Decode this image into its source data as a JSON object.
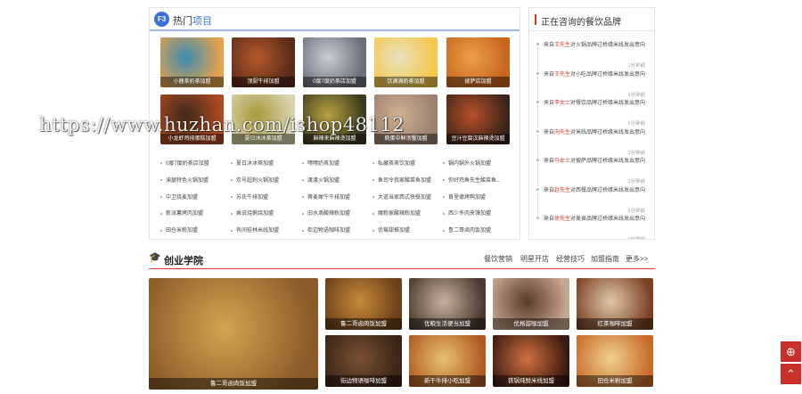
{
  "hot": {
    "badge": "F3",
    "title_pre": "热门",
    "title_post": "项目",
    "images": [
      {
        "caption": "小鹿茶奶茶加盟",
        "c1": "#e9a24c",
        "c2": "#3a8bb0"
      },
      {
        "caption": "顶厨牛排加盟",
        "c1": "#5a2a1a",
        "c2": "#b55a2a"
      },
      {
        "caption": "0度7度奶茶店加盟",
        "c1": "#6b6f7a",
        "c2": "#c8ccd4"
      },
      {
        "caption": "饮满满奶茶加盟",
        "c1": "#f5c84a",
        "c2": "#e8e0c0"
      },
      {
        "caption": "披萨店加盟",
        "c1": "#c8641e",
        "c2": "#e9a04a"
      },
      {
        "caption": "小龙虾鸡排蛋糕加盟",
        "c1": "#b04a22",
        "c2": "#3d2a1a"
      },
      {
        "caption": "夏日沐沐茶加盟",
        "c1": "#d8d4b0",
        "c2": "#a89a3a"
      },
      {
        "caption": "麻辣来麻辣烫加盟",
        "c1": "#3b3a20",
        "c2": "#b8a040"
      },
      {
        "caption": "蚝蛋中鲜汤蟹加盟",
        "c1": "#9a8070",
        "c2": "#d0b090"
      },
      {
        "caption": "豆汁豆腐汉麻辣烫加盟",
        "c1": "#3a2418",
        "c2": "#b8502a"
      }
    ],
    "tags": [
      "0度7度奶茶店加盟",
      "夏日沐沐茶加盟",
      "嘿嘿奶茶加盟",
      "私藏茶茶饮加盟",
      "锅内锅外火锅加盟",
      "渝瑟特色火锅加盟",
      "欢号超刺火锅加盟",
      "渡渡火锅加盟",
      "鱼司令我家酸菜鱼加盟",
      "你好鸡鱼先生酸菜鱼...",
      "中卫烧麦加盟",
      "苏氏牛排加盟",
      "蒋麦犀牛牛排加盟",
      "大道当家西式快餐加盟",
      "首里德烤鸭加盟",
      "新派薯烤肉加盟",
      "乘说烧鹅烧加盟",
      "旧水滴酸辣粉加盟",
      "魔粉家酸辣粉加盟",
      "西少冬肉夹馍加盟",
      "田仓米粉加盟",
      "有间桂林米线加盟",
      "街边物语咖啡加盟",
      "优莓甜推加盟",
      "鲁二哥卤肉饭加盟"
    ]
  },
  "consult": {
    "title": "正在咨询的餐饮品牌",
    "items": [
      {
        "pre": "来自",
        "name": "王先生",
        "post": "对火锅品牌过桥缘米线发出意向",
        "time": "1分钟前"
      },
      {
        "pre": "来自",
        "name": "王先生",
        "post": "对小吃品牌过桥缘米线发出意向",
        "time": "1分钟前"
      },
      {
        "pre": "来自",
        "name": "李女士",
        "post": "对餐饮品牌过桥缘米线发出意向",
        "time": "1分钟前"
      },
      {
        "pre": "来自",
        "name": "向先生",
        "post": "对米线品牌过桥缘米线发出意向",
        "time": "1分钟前"
      },
      {
        "pre": "来自",
        "name": "马女士",
        "post": "对披萨品牌过桥缘米线发出意向",
        "time": "1分钟前"
      },
      {
        "pre": "来自",
        "name": "赵先生",
        "post": "对西餐品牌过桥缘米线发出意向",
        "time": "1分钟前"
      },
      {
        "pre": "来自",
        "name": "徐先生",
        "post": "对美食品牌过桥缘米线发出意向",
        "time": "1分钟前"
      }
    ]
  },
  "academy": {
    "icon": "🎓",
    "title": "创业学院",
    "links": [
      "餐饮营销",
      "明星开店",
      "经营技巧",
      "加盟指南",
      "更多>>"
    ],
    "feature": {
      "caption": "鲁二哥卤肉饭加盟",
      "c1": "#8a5a28",
      "c2": "#d4a450"
    },
    "tiles": [
      {
        "caption": "鲁二哥卤肉饭加盟",
        "c1": "#6a4018",
        "c2": "#c88a3a"
      },
      {
        "caption": "优粮生活便当加盟",
        "c1": "#4a3a30",
        "c2": "#c8b0a0"
      },
      {
        "caption": "优格甜咖加盟",
        "c1": "#c8a890",
        "c2": "#5a3a2a"
      },
      {
        "caption": "红茶咖啡加盟",
        "c1": "#7a4020",
        "c2": "#e0c8a8"
      },
      {
        "caption": "街边物语咖啡加盟",
        "c1": "#3a2418",
        "c2": "#7a5030"
      },
      {
        "caption": "新干牛排小吃加盟",
        "c1": "#b05a22",
        "c2": "#e8c070"
      },
      {
        "caption": "铁锅炖鲜米线加盟",
        "c1": "#3a1a10",
        "c2": "#d07040"
      },
      {
        "caption": "田仓米粉加盟",
        "c1": "#c86a28",
        "c2": "#f0d090"
      }
    ]
  },
  "watermark": "https://www.huzhan.com/ishop48112",
  "floats": {
    "top": "⊕",
    "bottom": "⌃"
  }
}
